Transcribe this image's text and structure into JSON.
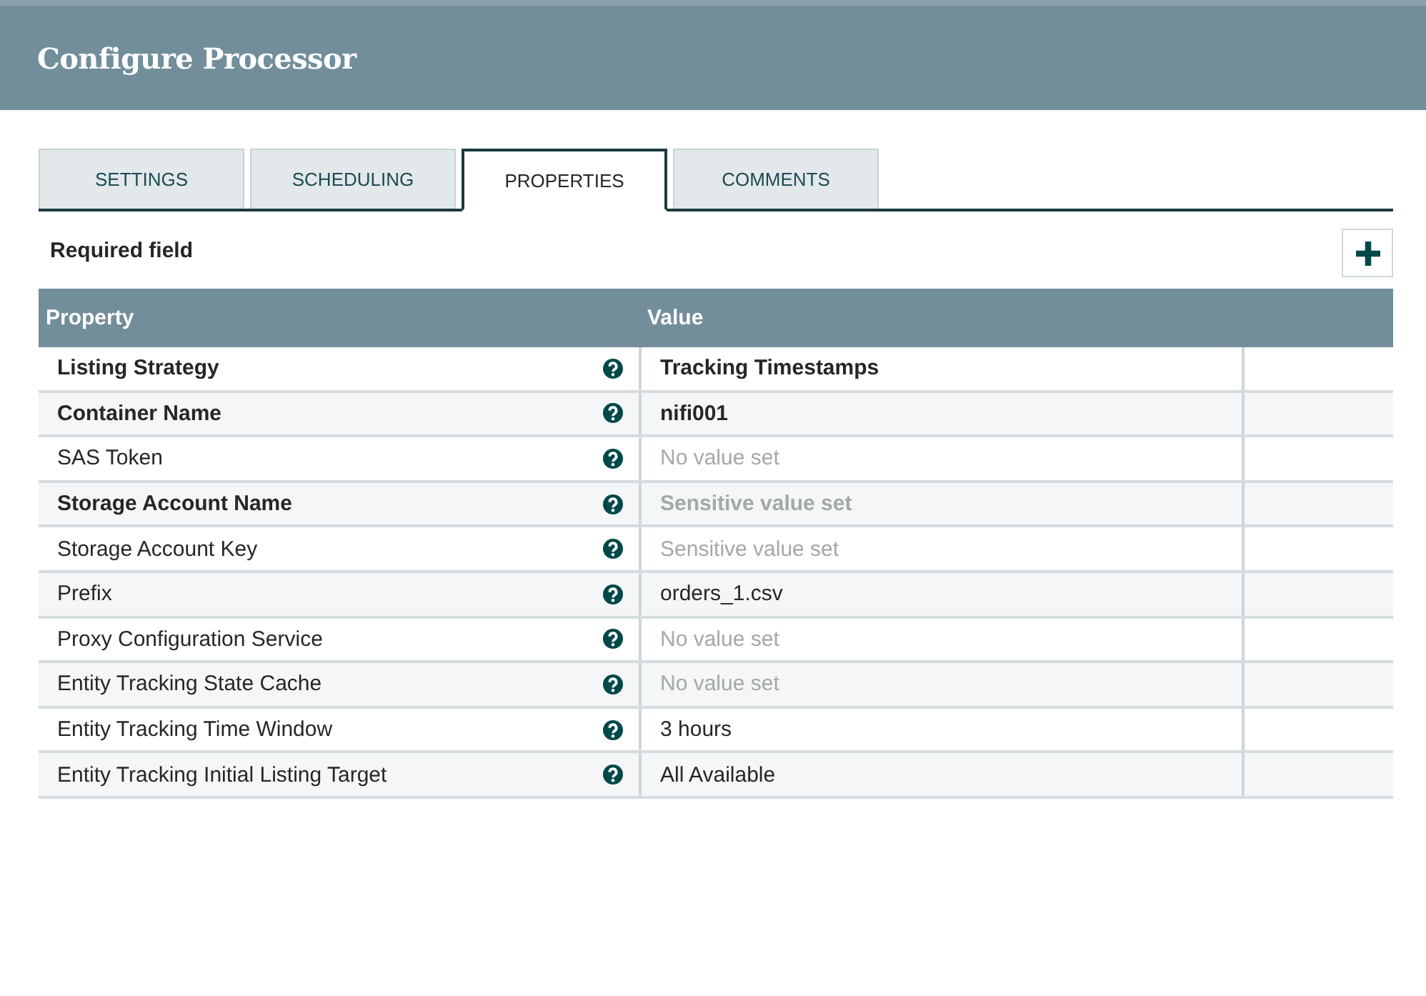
{
  "dialog": {
    "title": "Configure Processor"
  },
  "tabs": [
    {
      "label": "SETTINGS",
      "selected": false
    },
    {
      "label": "SCHEDULING",
      "selected": false
    },
    {
      "label": "PROPERTIES",
      "selected": true
    },
    {
      "label": "COMMENTS",
      "selected": false
    }
  ],
  "required_label": "Required field",
  "table": {
    "columns": [
      "Property",
      "Value"
    ],
    "rows": [
      {
        "property": "Listing Strategy",
        "required": true,
        "value": "Tracking Timestamps",
        "muted": false
      },
      {
        "property": "Container Name",
        "required": true,
        "value": "nifi001",
        "muted": false
      },
      {
        "property": "SAS Token",
        "required": false,
        "value": "No value set",
        "muted": true
      },
      {
        "property": "Storage Account Name",
        "required": true,
        "value": "Sensitive value set",
        "muted": true
      },
      {
        "property": "Storage Account Key",
        "required": false,
        "value": "Sensitive value set",
        "muted": true
      },
      {
        "property": "Prefix",
        "required": false,
        "value": "orders_1.csv",
        "muted": false
      },
      {
        "property": "Proxy Configuration Service",
        "required": false,
        "value": "No value set",
        "muted": true
      },
      {
        "property": "Entity Tracking State Cache",
        "required": false,
        "value": "No value set",
        "muted": true
      },
      {
        "property": "Entity Tracking Time Window",
        "required": false,
        "value": "3 hours",
        "muted": false
      },
      {
        "property": "Entity Tracking Initial Listing Target",
        "required": false,
        "value": "All Available",
        "muted": false
      }
    ]
  }
}
